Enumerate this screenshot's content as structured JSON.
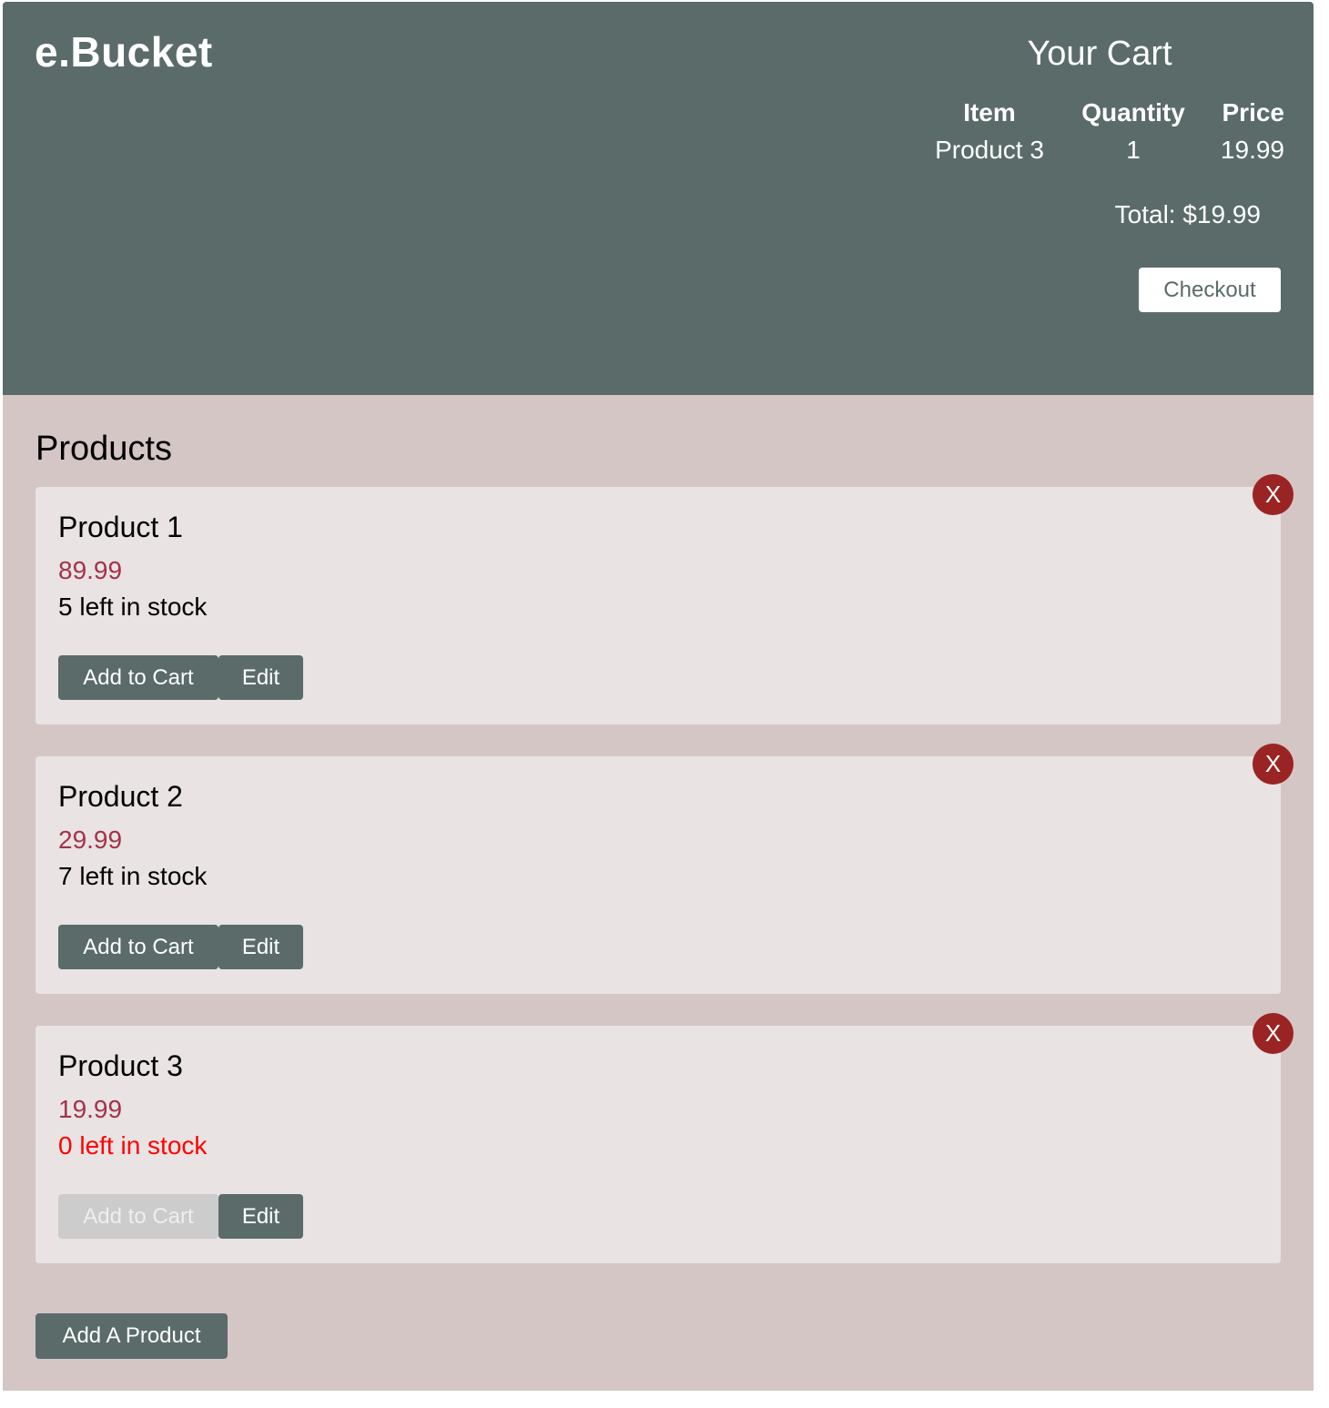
{
  "header": {
    "logo": "e.Bucket"
  },
  "cart": {
    "title": "Your Cart",
    "columns": {
      "item": "Item",
      "quantity": "Quantity",
      "price": "Price"
    },
    "items": [
      {
        "item": "Product 3",
        "quantity": "1",
        "price": "19.99"
      }
    ],
    "total": "Total: $19.99",
    "checkout_label": "Checkout"
  },
  "products": {
    "heading": "Products",
    "items": [
      {
        "name": "Product 1",
        "price": "89.99",
        "stock": "5 left in stock",
        "in_stock": true
      },
      {
        "name": "Product 2",
        "price": "29.99",
        "stock": "7 left in stock",
        "in_stock": true
      },
      {
        "name": "Product 3",
        "price": "19.99",
        "stock": "0 left in stock",
        "in_stock": false
      }
    ],
    "add_to_cart_label": "Add to Cart",
    "edit_label": "Edit",
    "delete_label": "X"
  },
  "add_product_label": "Add A Product",
  "colors": {
    "header_bg": "#5a6b6a",
    "main_bg": "#d5c6c6",
    "card_bg": "#e9e3e3",
    "price": "#a3334a",
    "out_of_stock": "#ff0000",
    "delete": "#9a2424",
    "disabled_button": "#cccccc"
  }
}
